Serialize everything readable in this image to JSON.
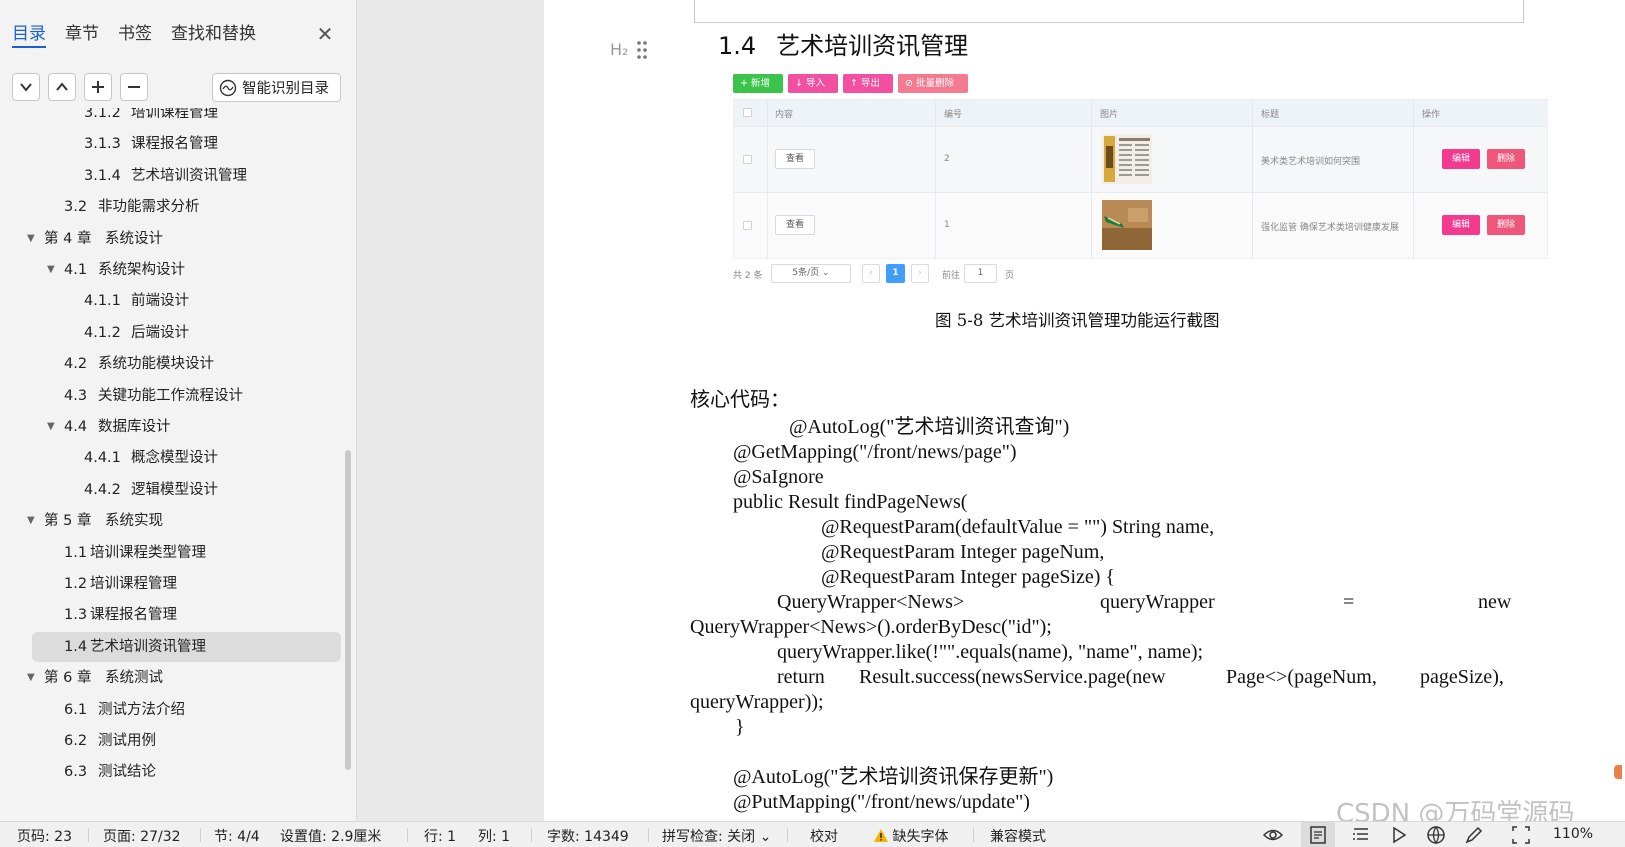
{
  "nav": {
    "tabs": [
      "目录",
      "章节",
      "书签",
      "查找和替换"
    ],
    "smart_toc_label": "智能识别目录",
    "toc": [
      {
        "num": "3.1.2",
        "text": "培训课程管理",
        "level": 3
      },
      {
        "num": "3.1.3",
        "text": "课程报名管理",
        "level": 3
      },
      {
        "num": "3.1.4",
        "text": "艺术培训资讯管理",
        "level": 3
      },
      {
        "num": "3.2",
        "text": "非功能需求分析",
        "level": 2
      },
      {
        "num": "第 4 章",
        "text": "系统设计",
        "level": 1,
        "expanded": true
      },
      {
        "num": "4.1",
        "text": "系统架构设计",
        "level": 2,
        "expanded": true
      },
      {
        "num": "4.1.1",
        "text": "前端设计",
        "level": 3
      },
      {
        "num": "4.1.2",
        "text": "后端设计",
        "level": 3
      },
      {
        "num": "4.2",
        "text": "系统功能模块设计",
        "level": 2
      },
      {
        "num": "4.3",
        "text": "关键功能工作流程设计",
        "level": 2
      },
      {
        "num": "4.4",
        "text": "数据库设计",
        "level": 2,
        "expanded": true
      },
      {
        "num": "4.4.1",
        "text": "概念模型设计",
        "level": 3
      },
      {
        "num": "4.4.2",
        "text": "逻辑模型设计",
        "level": 3
      },
      {
        "num": "第 5 章",
        "text": "系统实现",
        "level": 1,
        "expanded": true
      },
      {
        "num": "1.1",
        "text": "培训课程类型管理",
        "level": 2,
        "tight": true
      },
      {
        "num": "1.2",
        "text": "培训课程管理",
        "level": 2,
        "tight": true
      },
      {
        "num": "1.3",
        "text": "课程报名管理",
        "level": 2,
        "tight": true
      },
      {
        "num": "1.4",
        "text": "艺术培训资讯管理",
        "level": 2,
        "tight": true,
        "selected": true
      },
      {
        "num": "第 6 章",
        "text": "系统测试",
        "level": 1,
        "expanded": true
      },
      {
        "num": "6.1",
        "text": "测试方法介绍",
        "level": 2
      },
      {
        "num": "6.2",
        "text": "测试用例",
        "level": 2
      },
      {
        "num": "6.3",
        "text": "测试结论",
        "level": 2
      }
    ]
  },
  "doc": {
    "h2_marker": "H₂",
    "heading_num": "1.4",
    "heading_text": "艺术培训资讯管理",
    "screenshot": {
      "buttons": [
        {
          "label": "+ 新增",
          "color": "#3cc44a"
        },
        {
          "label": "↓ 导入",
          "color": "#f24fa0"
        },
        {
          "label": "↑ 导出",
          "color": "#f24fa0"
        },
        {
          "label": "⊘ 批量删除",
          "color": "#f47a8f"
        }
      ],
      "columns": [
        "内容",
        "编号",
        "图片",
        "标题",
        "操作"
      ],
      "rows": [
        {
          "content_btn": "查看",
          "id": "2",
          "title": "美术类艺术培训如何突围",
          "edit": "编辑",
          "delete": "删除"
        },
        {
          "content_btn": "查看",
          "id": "1",
          "title": "强化监管 确保艺术类培训健康发展",
          "edit": "编辑",
          "delete": "删除"
        }
      ],
      "pager": {
        "total": "共 2 条",
        "page_size": "5条/页",
        "current": "1",
        "goto_label": "前往",
        "goto_value": "1",
        "page_suffix": "页"
      }
    },
    "caption": "图 5-8  艺术培训资讯管理功能运行截图",
    "code_lines": [
      "核心代码：",
      "@AutoLog(\"艺术培训资讯查询\")",
      "@GetMapping(\"/front/news/page\")",
      "@SaIgnore",
      "public Result findPageNews(",
      "@RequestParam(defaultValue = \"\") String name,",
      "@RequestParam Integer pageNum,",
      "@RequestParam Integer pageSize) {",
      "QueryWrapper<News>",
      "queryWrapper",
      "=",
      "new",
      "QueryWrapper<News>().orderByDesc(\"id\");",
      "queryWrapper.like(!\"\".equals(name), \"name\", name);",
      "return",
      "Result.success(newsService.page(new",
      "Page<>(pageNum,",
      "pageSize),",
      "queryWrapper));",
      "}",
      "@AutoLog(\"艺术培训资讯保存更新\")",
      "@PutMapping(\"/front/news/update\")"
    ]
  },
  "status": {
    "page_code": "页码: 23",
    "page": "页面: 27/32",
    "section": "节: 4/4",
    "setting": "设置值: 2.9厘米",
    "row": "行: 1",
    "col": "列: 1",
    "words": "字数: 14349",
    "spell": "拼写检查: 关闭",
    "proof": "校对",
    "missing_font": "缺失字体",
    "compat": "兼容模式",
    "zoom": "110%"
  },
  "watermark": "CSDN @万码堂源码"
}
